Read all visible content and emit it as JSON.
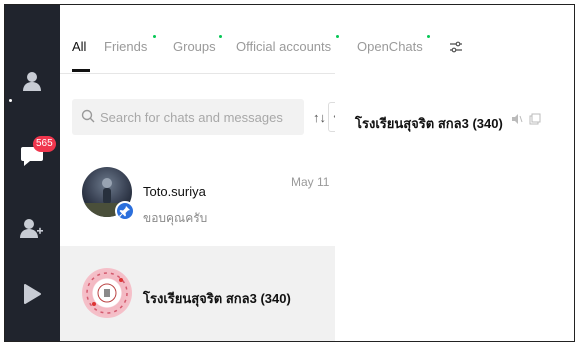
{
  "tabs": [
    {
      "label": "All",
      "active": true
    },
    {
      "label": "Friends",
      "has_new": true
    },
    {
      "label": "Groups",
      "has_new": true
    },
    {
      "label": "Official accounts",
      "has_new": true
    },
    {
      "label": "OpenChats",
      "has_new": true
    }
  ],
  "sidebar": {
    "badge_count": "565",
    "icons": [
      "person-icon",
      "chat-bubble-icon",
      "add-friend-icon",
      "play-icon"
    ]
  },
  "search": {
    "placeholder": "Search for chats and messages"
  },
  "chats": [
    {
      "name": "Toto.suriya",
      "preview": "ขอบคุณครับ",
      "time": "May 11",
      "pinned": true
    },
    {
      "name": "โรงเรียนสุจริต สกล3 (340)",
      "preview": "",
      "time": "",
      "selected": true
    }
  ],
  "conversation": {
    "title": "โรงเรียนสุจริต สกล3 (340)"
  },
  "colors": {
    "rail": "#20242d",
    "badge": "#f0364d",
    "new_dot": "#06c755",
    "pin": "#2b6fdc",
    "selected_row": "#f1f1f1"
  }
}
